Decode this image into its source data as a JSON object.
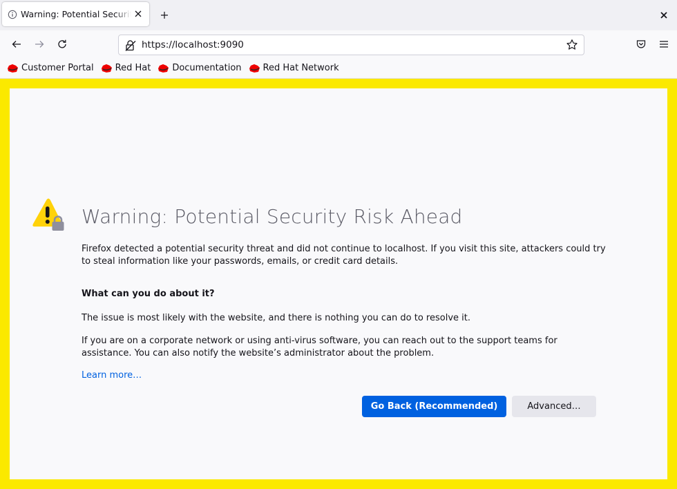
{
  "tab": {
    "title": "Warning: Potential Security Risk Ahead",
    "icon": "info-icon"
  },
  "toolbar": {
    "back_icon": "back-arrow-icon",
    "forward_icon": "forward-arrow-icon",
    "reload_icon": "reload-icon",
    "pocket_icon": "pocket-icon",
    "menu_icon": "hamburger-menu-icon"
  },
  "urlbar": {
    "url": "https://localhost:9090",
    "security_icon": "insecure-lock-icon",
    "bookmark_icon": "star-icon"
  },
  "bookmarks": [
    {
      "label": "Customer Portal",
      "icon": "redhat-icon"
    },
    {
      "label": "Red Hat",
      "icon": "redhat-icon"
    },
    {
      "label": "Documentation",
      "icon": "redhat-icon"
    },
    {
      "label": "Red Hat Network",
      "icon": "redhat-icon"
    }
  ],
  "page": {
    "title": "Warning: Potential Security Risk Ahead",
    "intro": "Firefox detected a potential security threat and did not continue to localhost. If you visit this site, attackers could try to steal information like your passwords, emails, or credit card details.",
    "what_heading": "What can you do about it?",
    "issue_text": "The issue is most likely with the website, and there is nothing you can do to resolve it.",
    "network_text": "If you are on a corporate network or using anti-virus software, you can reach out to the support teams for assistance. You can also notify the website’s administrator about the problem.",
    "learn_more": "Learn more…",
    "go_back_label": "Go Back (Recommended)",
    "advanced_label": "Advanced…"
  },
  "colors": {
    "frame": "#fbe900",
    "primary_button": "#0061e0",
    "link": "#0061e0",
    "warning_icon": "#ffd20a"
  }
}
